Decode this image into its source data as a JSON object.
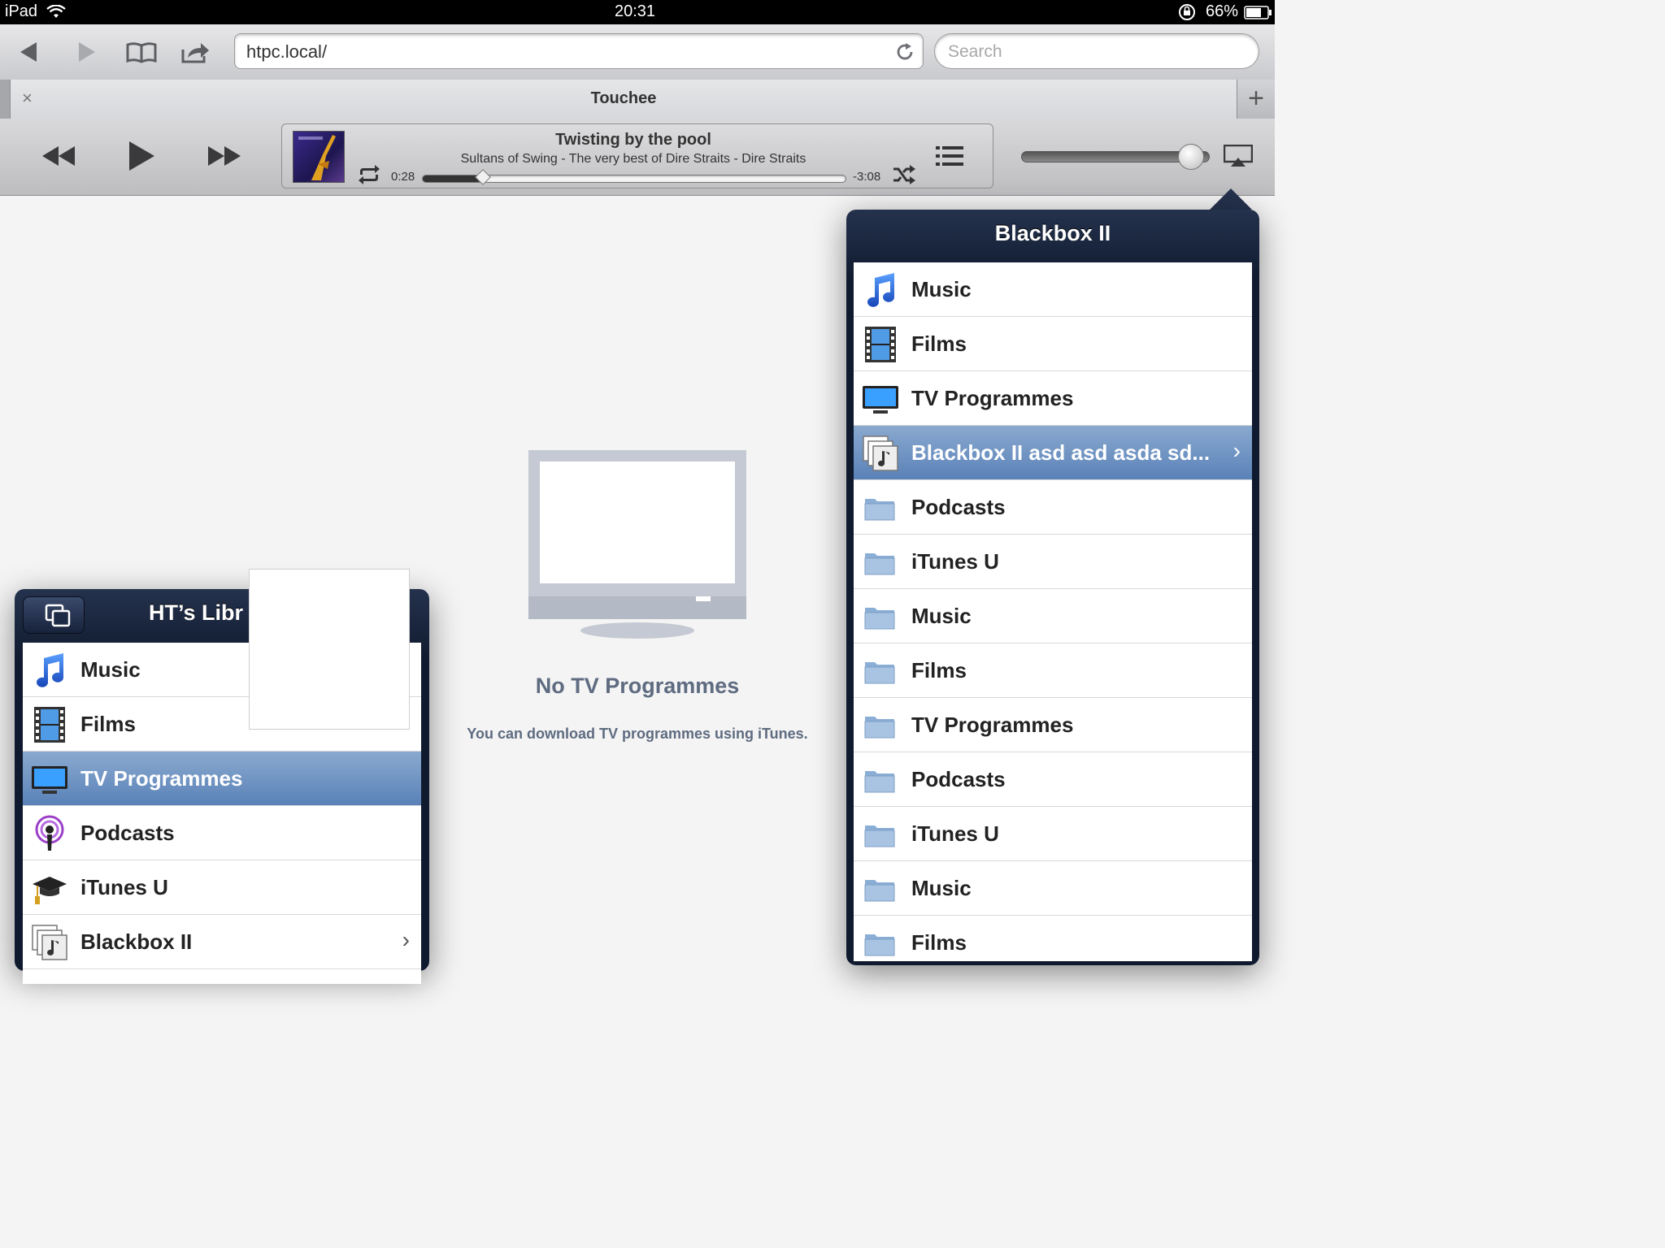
{
  "status_bar": {
    "device": "iPad",
    "time": "20:31",
    "battery": "66%"
  },
  "browser": {
    "url": "htpc.local/",
    "search_placeholder": "Search",
    "tab_title": "Touchee",
    "close_tab_label": "×",
    "new_tab_label": "+"
  },
  "player": {
    "song_title": "Twisting by the pool",
    "song_subtitle": "Sultans of Swing - The very best of Dire Straits - Dire Straits",
    "elapsed": "0:28",
    "remaining": "-3:08",
    "progress_fraction": 0.14,
    "volume_fraction": 0.9
  },
  "empty_state": {
    "title": "No TV Programmes",
    "subtitle": "You can download TV programmes using iTunes."
  },
  "right_popover": {
    "title": "Blackbox II",
    "items": [
      {
        "label": "Music",
        "icon": "music-note-icon"
      },
      {
        "label": "Films",
        "icon": "film-strip-icon"
      },
      {
        "label": "TV Programmes",
        "icon": "tv-icon"
      },
      {
        "label": "Blackbox II asd asd asda sd...",
        "icon": "playlist-stack-icon",
        "selected": true,
        "chevron": "›"
      },
      {
        "label": "Podcasts",
        "icon": "folder-icon"
      },
      {
        "label": "iTunes U",
        "icon": "folder-icon"
      },
      {
        "label": "Music",
        "icon": "folder-icon"
      },
      {
        "label": "Films",
        "icon": "folder-icon"
      },
      {
        "label": "TV Programmes",
        "icon": "folder-icon"
      },
      {
        "label": "Podcasts",
        "icon": "folder-icon"
      },
      {
        "label": "iTunes U",
        "icon": "folder-icon"
      },
      {
        "label": "Music",
        "icon": "folder-icon"
      },
      {
        "label": "Films",
        "icon": "folder-icon"
      }
    ]
  },
  "left_popover": {
    "title": "HT’s Libr",
    "items": [
      {
        "label": "Music",
        "icon": "music-note-icon"
      },
      {
        "label": "Films",
        "icon": "film-strip-icon"
      },
      {
        "label": "TV Programmes",
        "icon": "tv-icon",
        "selected": true
      },
      {
        "label": "Podcasts",
        "icon": "podcast-icon"
      },
      {
        "label": "iTunes U",
        "icon": "graduation-cap-icon"
      },
      {
        "label": "Blackbox II",
        "icon": "playlist-stack-icon",
        "chevron": "›"
      }
    ]
  },
  "colors": {
    "selection": "#6a8fc2",
    "popover_header": "#1b2640",
    "empty_text": "#5e6b80"
  }
}
